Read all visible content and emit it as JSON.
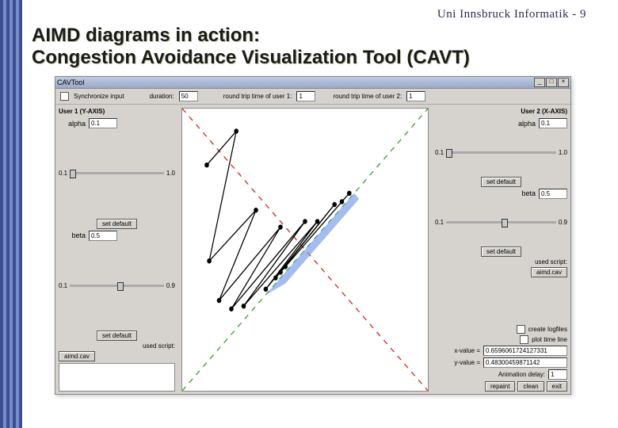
{
  "slide": {
    "header": "Uni Innsbruck Informatik - 9",
    "title_line1": "AIMD diagrams in action:",
    "title_line2": "Congestion Avoidance Visualization Tool (CAVT)"
  },
  "window": {
    "title": "CAVTool",
    "buttons": {
      "min": "_",
      "max": "□",
      "close": "×"
    }
  },
  "toolbar": {
    "sync_label": "Synchronize input",
    "duration_label": "duration:",
    "duration_value": "50",
    "rtt1_label": "round trip time of user 1:",
    "rtt1_value": "1",
    "rtt2_label": "round trip time of user 2:",
    "rtt2_value": "1"
  },
  "user1": {
    "header": "User 1 (Y-AXIS)",
    "alpha_label": "alpha",
    "alpha_value": "0.1",
    "alpha_lo": "0.1",
    "alpha_hi": "1.0",
    "beta_label": "beta",
    "beta_value": "0.5",
    "beta_lo": "0.1",
    "beta_hi": "0.9",
    "set_default": "set default",
    "used_script": "used script:",
    "script_name": "aimd.cav"
  },
  "user2": {
    "header": "User 2 (X-AXIS)",
    "alpha_label": "alpha",
    "alpha_value": "0.1",
    "alpha_lo": "0.1",
    "alpha_hi": "1.0",
    "beta_label": "beta",
    "beta_value": "0.5",
    "beta_lo": "0.1",
    "beta_hi": "0.9",
    "set_default": "set default",
    "used_script": "used script:",
    "script_name": "aimd.cav"
  },
  "footer": {
    "logfiles": "create logfiles",
    "plotline": "plot time line",
    "xval_label": "x-value =",
    "xval": "0.6596061724127331",
    "yval_label": "y-value =",
    "yval": "0.48300459871142",
    "anim_label": "Animation delay:",
    "anim_value": "1",
    "repaint": "repaint",
    "clean": "clean",
    "exit": "exit"
  },
  "chart_data": {
    "type": "line",
    "title": "",
    "xlim": [
      0,
      1
    ],
    "ylim": [
      0,
      1
    ],
    "guides": {
      "fairness_line": "y = x",
      "efficiency_line": "x + y = 1"
    },
    "trajectories": [
      {
        "name": "aimd",
        "points": [
          [
            0.1,
            0.8
          ],
          [
            0.22,
            0.92
          ],
          [
            0.11,
            0.46
          ],
          [
            0.3,
            0.64
          ],
          [
            0.15,
            0.32
          ],
          [
            0.4,
            0.58
          ],
          [
            0.2,
            0.29
          ],
          [
            0.5,
            0.6
          ],
          [
            0.25,
            0.3
          ],
          [
            0.55,
            0.6
          ],
          [
            0.34,
            0.36
          ],
          [
            0.62,
            0.66
          ],
          [
            0.38,
            0.4
          ],
          [
            0.65,
            0.67
          ],
          [
            0.4,
            0.42
          ],
          [
            0.68,
            0.7
          ],
          [
            0.42,
            0.44
          ]
        ]
      }
    ]
  }
}
